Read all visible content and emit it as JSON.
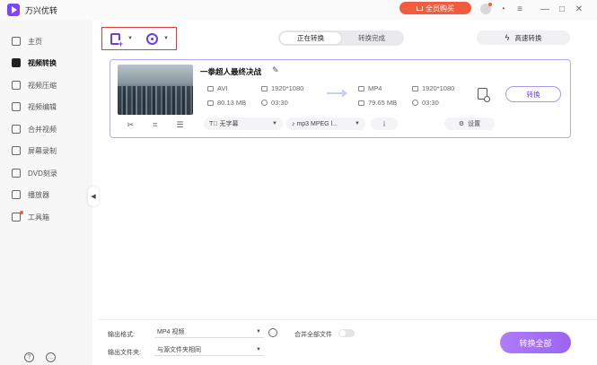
{
  "app": {
    "title": "万兴优转",
    "buy_label": "全员购买"
  },
  "titlebar_icons": [
    "user-avatar-icon",
    "headset-icon",
    "menu-icon",
    "minimize-icon",
    "maximize-icon",
    "close-icon"
  ],
  "sidebar": {
    "items": [
      {
        "label": "主页",
        "icon": "home-icon",
        "active": false
      },
      {
        "label": "视频转换",
        "icon": "convert-icon",
        "active": true
      },
      {
        "label": "视频压缩",
        "icon": "compress-icon",
        "active": false
      },
      {
        "label": "视频编辑",
        "icon": "scissors-icon",
        "active": false
      },
      {
        "label": "合并视频",
        "icon": "merge-icon",
        "active": false
      },
      {
        "label": "屏幕录制",
        "icon": "screen-record-icon",
        "active": false
      },
      {
        "label": "DVD刻录",
        "icon": "dvd-icon",
        "active": false
      },
      {
        "label": "播放器",
        "icon": "player-icon",
        "active": false
      },
      {
        "label": "工具箱",
        "icon": "toolbox-icon",
        "active": false
      }
    ]
  },
  "toolbar": {
    "tabs": [
      {
        "label": "正在转换",
        "active": true
      },
      {
        "label": "转换完成",
        "active": false
      }
    ],
    "speed_label": "高速转换"
  },
  "task": {
    "title": "一拳超人最终决战",
    "source": {
      "format": "AVI",
      "resolution": "1920*1080",
      "size": "80.13 MB",
      "duration": "03:30"
    },
    "target": {
      "format": "MP4",
      "resolution": "1920*1080",
      "size": "79.65 MB",
      "duration": "03:30"
    },
    "convert_label": "转换",
    "subtitle_label": "无字幕",
    "audio_label": "mp3 MPEG l...",
    "info_glyph": "i",
    "settings_label": "设置"
  },
  "footer": {
    "output_format_label": "输出格式:",
    "output_format_value": "MP4 视频",
    "output_folder_label": "输出文件夹:",
    "output_folder_value": "与源文件夹相同",
    "merge_label": "合并全部文件",
    "convert_all_label": "转换全部"
  },
  "colors": {
    "accent": "#6a3cf0",
    "buy": "#f35b3f",
    "highlight_box": "#e03a3a"
  }
}
